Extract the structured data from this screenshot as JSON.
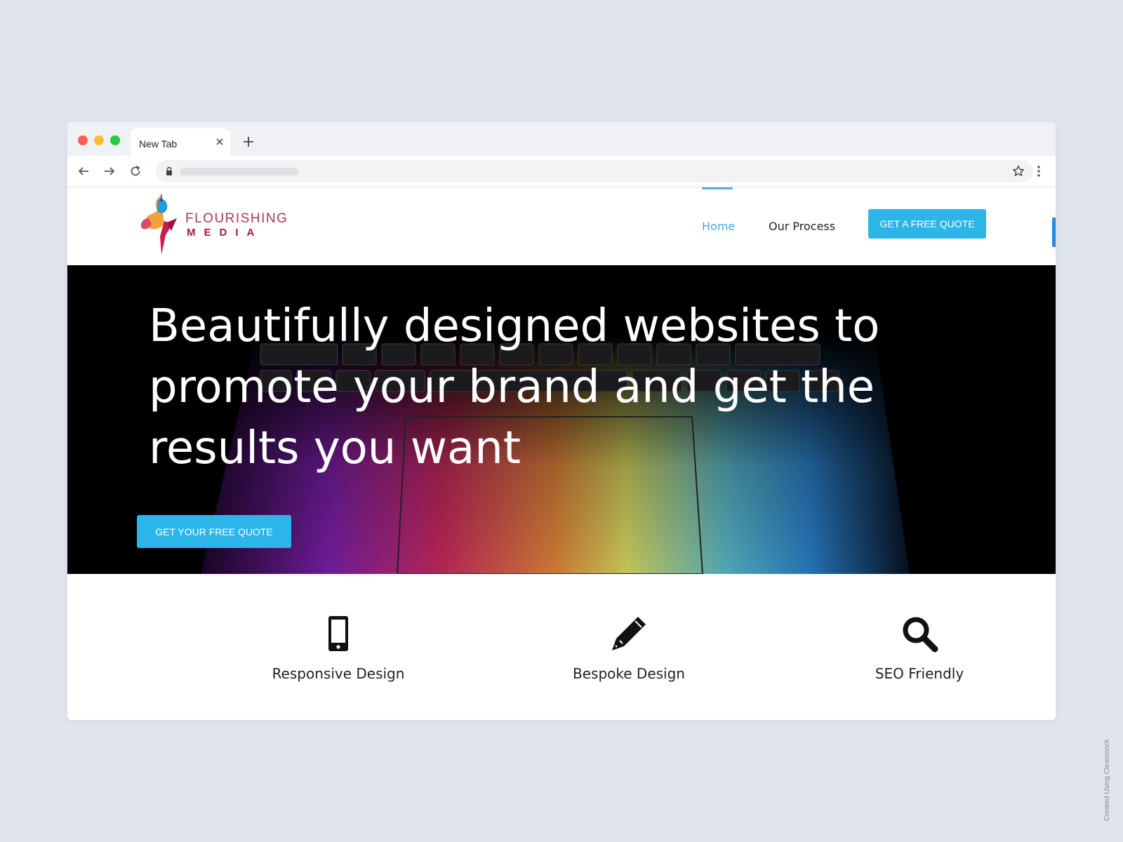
{
  "browser": {
    "tab_title": "New Tab",
    "icons": [
      "close-icon",
      "plus-icon",
      "back-arrow-icon",
      "forward-arrow-icon",
      "reload-icon",
      "lock-icon",
      "star-icon",
      "menu-dots-icon"
    ]
  },
  "site": {
    "logo": {
      "line1": "FLOURISHING",
      "line2": "MEDIA"
    },
    "nav": [
      {
        "label": "Home",
        "active": true
      },
      {
        "label": "Our Process",
        "active": false
      }
    ],
    "cta": "GET A FREE QUOTE"
  },
  "hero": {
    "title": "Beautifully designed websites to promote your brand and get the results you want",
    "button": "GET YOUR FREE QUOTE"
  },
  "features": [
    {
      "icon": "mobile-phone-icon",
      "label": "Responsive Design"
    },
    {
      "icon": "pencil-icon",
      "label": "Bespoke Design"
    },
    {
      "icon": "search-icon",
      "label": "SEO Friendly"
    }
  ],
  "colors": {
    "accent": "#2bb5e8",
    "nav_active": "#4aa8e8",
    "page_background": "#e0e5ed",
    "logo_primary": "#a8174a"
  },
  "watermark": "Created Using Cleanmock"
}
